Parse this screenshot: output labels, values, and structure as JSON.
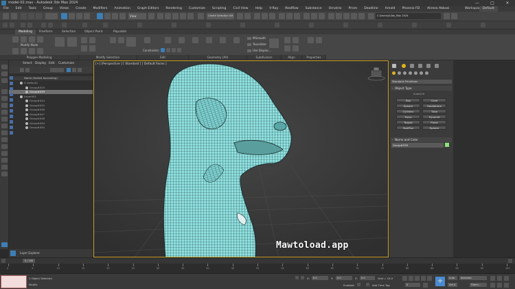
{
  "window": {
    "title": "model-02.max - Autodesk 3ds Max 2024",
    "controls": [
      "—",
      "□",
      "✕"
    ]
  },
  "menu": {
    "items": [
      "File",
      "Edit",
      "Tools",
      "Group",
      "Views",
      "Create",
      "Modifiers",
      "Animation",
      "Graph Editors",
      "Rendering",
      "Customize",
      "Scripting",
      "Civil View",
      "Help",
      "V-Ray",
      "Realflow",
      "Substance",
      "Ornatrix",
      "Prism",
      "Deadline",
      "Arnold",
      "Phoenix FD"
    ],
    "user": "Alireza Abbasi",
    "workspaces_label": "Workspaces:",
    "workspaces_value": "Default"
  },
  "toolbar": {
    "view_dropdown": "View",
    "selection_set": "Create Selection Set",
    "path_field": "C:\\Users\\a\\3ds_Max 2024"
  },
  "ribbon": {
    "tabs": [
      "Modeling",
      "Freeform",
      "Selection",
      "Object Paint",
      "Populate"
    ],
    "sections": [
      "Polygon Modeling",
      "Modify Selection",
      "Edit",
      "Geometry (All)",
      "Subdivision",
      "Align",
      "Properties"
    ],
    "modify_mode": "Modify Mode",
    "constraints": "Constraints:",
    "subdiv": [
      "MSmooth",
      "Tessellate",
      "Use Displac..."
    ]
  },
  "scene_explorer": {
    "tabs": [
      "Select",
      "Display",
      "Edit",
      "Customize"
    ],
    "header": "Name (Sorted Ascending)",
    "rows": [
      {
        "label": "0 (default)",
        "state": "hdr"
      },
      {
        "label": "Group#025",
        "state": ""
      },
      {
        "label": "Group#039",
        "state": "sel"
      },
      {
        "label": "Layer001",
        "state": "hdr"
      },
      {
        "label": "Group#044",
        "state": ""
      },
      {
        "label": "Group#045",
        "state": ""
      },
      {
        "label": "Group#046",
        "state": ""
      },
      {
        "label": "Group#047",
        "state": ""
      },
      {
        "label": "Group#048",
        "state": ""
      },
      {
        "label": "Group#049",
        "state": ""
      },
      {
        "label": "Group#050",
        "state": ""
      }
    ],
    "layer_label": "Layer Explorer"
  },
  "viewport": {
    "label": "[+] [Perspective ] [ Standard ] [ Default Faces ]"
  },
  "command_panel": {
    "category": "Standard Primitives",
    "object_type_header": "Object Type",
    "autogrid": "AutoGrid",
    "buttons": [
      "Box",
      "Cone",
      "Sphere",
      "GeoSphere",
      "Cylinder",
      "Tube",
      "Torus",
      "Pyramid",
      "Teapot",
      "Plane",
      "TextPlus",
      "Sphere"
    ],
    "name_color_header": "Name and Color",
    "name_value": "Group#039",
    "swatch_color": "#8fe07a"
  },
  "timeline": {
    "frame": "0 / 100",
    "ticks": [
      "0",
      "5",
      "10",
      "15",
      "20",
      "25",
      "30",
      "35",
      "40",
      "45",
      "50",
      "55",
      "60",
      "65",
      "70",
      "75",
      "80",
      "85",
      "90",
      "95",
      "100"
    ]
  },
  "status": {
    "selected": "1 Object Selected",
    "prompt": "Modify",
    "x_label": "X:",
    "x_value": "0.0",
    "y_label": "Y:",
    "y_value": "0.0",
    "z_label": "Z:",
    "z_value": "0.0",
    "grid": "Grid = 10.0",
    "enabled": "Enabled:",
    "add_time_tag": "Add Time Tag",
    "autokey": "Auto",
    "selected_dd": "Selected",
    "setkey": "Set K.",
    "filters": "Filters...",
    "frame_field": "0"
  },
  "watermark": "Mawtoload.app"
}
